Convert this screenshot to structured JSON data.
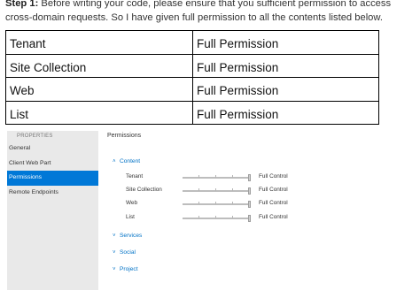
{
  "intro": {
    "step_label": "Step 1:",
    "text": " Before writing your code, please ensure that you sufficient permission to access cross-domain requests. So I have given full permission to all the contents listed below."
  },
  "permission_table": [
    {
      "scope": "Tenant",
      "permission": "Full Permission"
    },
    {
      "scope": "Site Collection",
      "permission": "Full Permission"
    },
    {
      "scope": "Web",
      "permission": "Full Permission"
    },
    {
      "scope": "List",
      "permission": "Full Permission"
    }
  ],
  "properties_panel": {
    "header": "PROPERTIES",
    "items": [
      "General",
      "Client Web Part",
      "Permissions",
      "Remote Endpoints"
    ],
    "selected": "Permissions"
  },
  "permissions_page": {
    "title": "Permissions",
    "groups": {
      "content": "Content",
      "services": "Services",
      "social": "Social",
      "project": "Project"
    },
    "rows": [
      {
        "label": "Tenant",
        "value": "Full Control"
      },
      {
        "label": "Site Collection",
        "value": "Full Control"
      },
      {
        "label": "Web",
        "value": "Full Control"
      },
      {
        "label": "List",
        "value": "Full Control"
      }
    ]
  },
  "colors": {
    "accent": "#0078d7",
    "link": "#0072c6",
    "panel_bg": "#e9e9e9"
  }
}
